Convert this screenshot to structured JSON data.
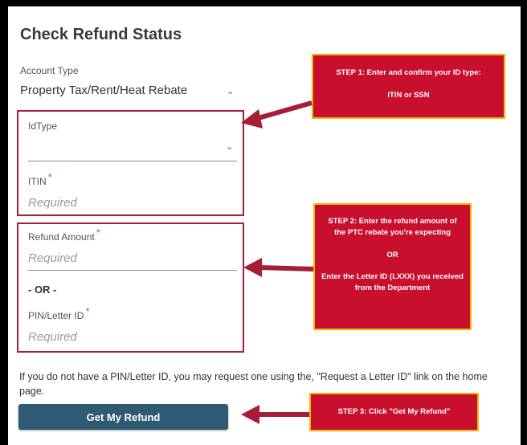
{
  "form": {
    "title": "Check Refund Status",
    "account_type_label": "Account Type",
    "account_type_value": "Property Tax/Rent/Heat Rebate",
    "idtype_label": "IdType",
    "idtype_value": "",
    "itin_label": "ITIN",
    "itin_placeholder": "Required",
    "refund_amount_label": "Refund Amount",
    "refund_amount_placeholder": "Required",
    "or_text": "- OR -",
    "pin_label": "PIN/Letter ID",
    "pin_placeholder": "Required",
    "required_mark": "*",
    "info_text": "If you do not have a PIN/Letter ID, you may request one using the, \"Request a Letter ID\" link on the home page.",
    "submit_label": "Get My Refund"
  },
  "callouts": {
    "step1_line1": "STEP 1:  Enter and confirm your ID type:",
    "step1_line2": "ITIN or SSN",
    "step2_line1": "STEP 2:  Enter the refund amount of the PTC rebate you're expecting",
    "step2_or": "OR",
    "step2_line2": "Enter the Letter ID (LXXX) you received from the Department",
    "step3": "STEP 3:  Click \"Get My Refund\""
  },
  "colors": {
    "callout_bg": "#c8102e",
    "callout_border": "#f2b600",
    "highlight_border": "#a51d37",
    "button_bg": "#2e5b73",
    "arrow": "#a51d37"
  },
  "icons": {
    "dropdown": "chevron-down-icon",
    "arrow": "arrow-left-icon"
  }
}
